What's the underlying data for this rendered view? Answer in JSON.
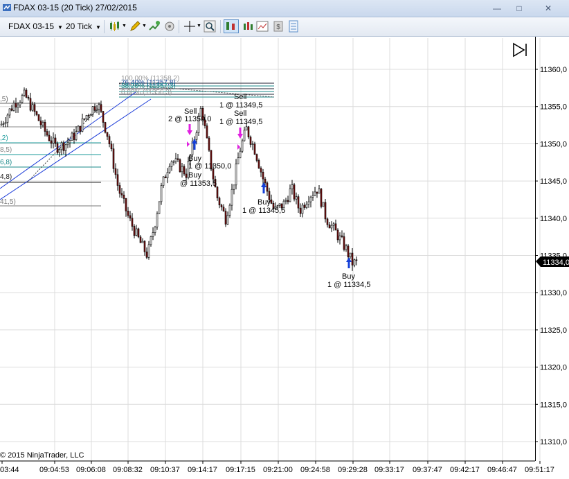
{
  "window": {
    "title": "FDAX 03-15 (20 Tick)  27/02/2015"
  },
  "toolbar": {
    "instrument": "FDAX 03-15",
    "interval": "20 Tick",
    "icons": [
      "candlestick-icon",
      "pencil-draw-icon",
      "add-indicator-icon",
      "crosshair-icon",
      "zoom-icon",
      "chart-trader-icon",
      "bar-type-icon",
      "properties-icon",
      "money-icon",
      "data-box-icon"
    ]
  },
  "chart": {
    "price_labels": [
      "11360,0",
      "11355,0",
      "11350,0",
      "11345,0",
      "11340,0",
      "11335,0",
      "11330,0",
      "11325,0",
      "11320,0",
      "11315,0",
      "11310,0"
    ],
    "current_price": "11334,0",
    "time_labels": [
      "03:44",
      "09:04:53",
      "09:06:08",
      "09:08:32",
      "09:10:37",
      "09:14:17",
      "09:17:15",
      "09:21:00",
      "09:24:58",
      "09:29:28",
      "09:33:17",
      "09:37:47",
      "09:42:17",
      "09:46:47",
      "09:51:17"
    ],
    "fib_labels": [
      "100,00% (11358,2)",
      "76,40% (11357,8)",
      "38,20% (11357,3)",
      "0,00% (11356,3)"
    ],
    "left_fib_labels": [
      ",5)",
      "8,5)",
      "6,8)",
      "4,8)",
      "41,5)",
      ",2)"
    ],
    "executions": [
      {
        "side": "Sell",
        "qty": "2 @ 11350,0"
      },
      {
        "side": "Buy",
        "qty": "1 @ 11350,0"
      },
      {
        "side": "Buy",
        "qty": "@ 11353,5"
      },
      {
        "side": "Sell",
        "qty": "1 @ 11349,5"
      },
      {
        "side": "Sell",
        "qty": "1 @ 11349,5"
      },
      {
        "side": "Buy",
        "qty": "1 @ 11345,5"
      },
      {
        "side": "Buy",
        "qty": "1 @ 11334,5"
      }
    ],
    "colors": {
      "up": "#ffffff",
      "down": "#7a1010",
      "buy_arrow": "#1540d8",
      "sell_arrow": "#e020e0",
      "grid": "#dcdcdc"
    }
  },
  "footer": {
    "copyright": "© 2015 NinjaTrader, LLC"
  }
}
